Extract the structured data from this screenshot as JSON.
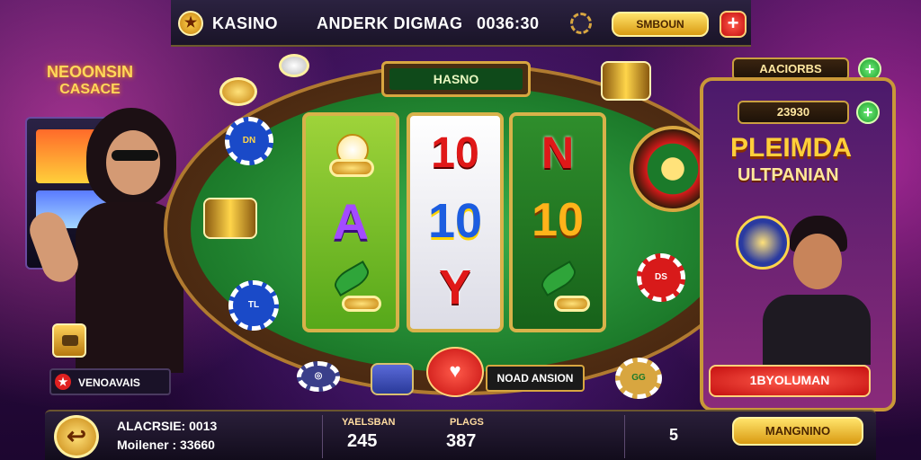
{
  "header": {
    "brand": "KASINO",
    "title": "ANDERK DIGMAG",
    "balance": "0036:30",
    "gold_button": "SMBOUN",
    "plus_icon": "plus-icon"
  },
  "table": {
    "banner": "HASNO",
    "reels": [
      {
        "top": "flower",
        "mid": "A",
        "bottom": "leaf"
      },
      {
        "top": "10",
        "mid": "10",
        "bottom": "Y"
      },
      {
        "top": "N",
        "mid": "10",
        "bottom": "leaf"
      }
    ],
    "controls": {
      "center_button": "NOAD ANSION"
    }
  },
  "left_panel": {
    "neon_sign_line1": "NEOONSIN",
    "neon_sign_line2": "CASACE",
    "bottom_label": "VENOAVAIS"
  },
  "right_panel": {
    "top_field": "AACIORBS",
    "score_field": "23930",
    "title_line1": "PLEIMDA",
    "title_line2": "ULTPANIAN",
    "action_button": "1BYOLUMAN"
  },
  "bottom_bar": {
    "line1": "ALACRSIE: 0013",
    "line2": "Moilener : 33660",
    "stat1_label": "YAELSBAN",
    "stat1_value": "245",
    "stat2_label": "PLAGS",
    "stat2_value": "387",
    "count": "5",
    "action_button": "MANGNINO"
  },
  "colors": {
    "accent_gold": "#f2b21f",
    "felt_green": "#2f9a3e",
    "purple_bg": "#3a1152",
    "red": "#d81a1a"
  }
}
